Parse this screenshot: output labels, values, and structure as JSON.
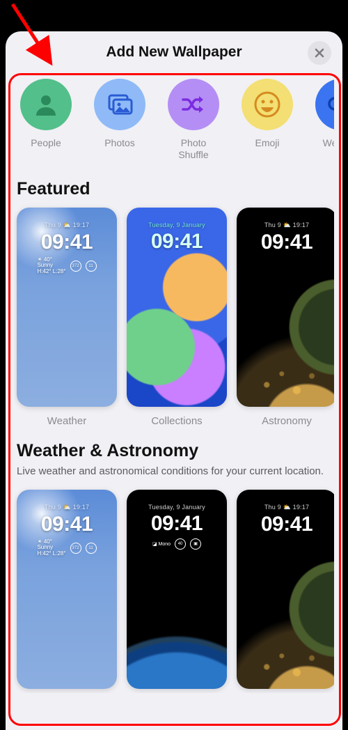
{
  "header": {
    "title": "Add New Wallpaper"
  },
  "categories": [
    {
      "id": "people",
      "label": "People",
      "bg": "#53bf8a",
      "fg": "#2a8a5b",
      "icon": "person"
    },
    {
      "id": "photos",
      "label": "Photos",
      "bg": "#8fbaf7",
      "fg": "#2a5bd4",
      "icon": "gallery"
    },
    {
      "id": "shuffle",
      "label": "Photo\nShuffle",
      "bg": "#b48ef5",
      "fg": "#7b2be0",
      "icon": "shuffle"
    },
    {
      "id": "emoji",
      "label": "Emoji",
      "bg": "#f3df73",
      "fg": "#d58a1f",
      "icon": "smiley"
    },
    {
      "id": "weather",
      "label": "Weather",
      "bg": "#3a74f0",
      "fg": "#0d3fb0",
      "icon": "cloud"
    }
  ],
  "sections": {
    "featured": {
      "title": "Featured",
      "cards": [
        {
          "id": "weather",
          "label": "Weather",
          "bg": "bg-weather",
          "date": "Thu 9 ⛅ 19:17",
          "time": "09:41",
          "show_widgets": true,
          "date_color": "#d8e6ff",
          "time_color": "#ffffff"
        },
        {
          "id": "collections",
          "label": "Collections",
          "bg": "bg-collections",
          "date": "Tuesday, 9 January",
          "time": "09:41",
          "show_widgets": false,
          "date_color": "#6fe3c9",
          "time_color": "#d8fff4"
        },
        {
          "id": "astronomy",
          "label": "Astronomy",
          "bg": "bg-astronomy",
          "date": "Thu 9 ⛅ 19:17",
          "time": "09:41",
          "show_widgets": false,
          "date_color": "#d0d0d0",
          "time_color": "#ffffff"
        }
      ]
    },
    "weather_astro": {
      "title": "Weather & Astronomy",
      "subtitle": "Live weather and astronomical conditions for your current location.",
      "cards": [
        {
          "id": "wa-weather",
          "bg": "bg-weather",
          "date": "Thu 9 ⛅ 19:17",
          "time": "09:41",
          "show_widgets": true,
          "date_color": "#d8e6ff",
          "time_color": "#ffffff"
        },
        {
          "id": "wa-earth",
          "bg": "bg-astro-earth",
          "date": "Tuesday, 9 January",
          "time": "09:41",
          "show_widgets": true,
          "date_color": "#d0d0d0",
          "time_color": "#ffffff"
        },
        {
          "id": "wa-night",
          "bg": "bg-astronomy",
          "date": "Thu 9 ⛅ 19:17",
          "time": "09:41",
          "show_widgets": false,
          "date_color": "#d0d0d0",
          "time_color": "#ffffff"
        }
      ]
    }
  },
  "lockscreen_widgets": {
    "temp": "40°",
    "cond": "Sunny",
    "range": "H:42° L:28°",
    "ring1": "372",
    "ring2": "11"
  }
}
